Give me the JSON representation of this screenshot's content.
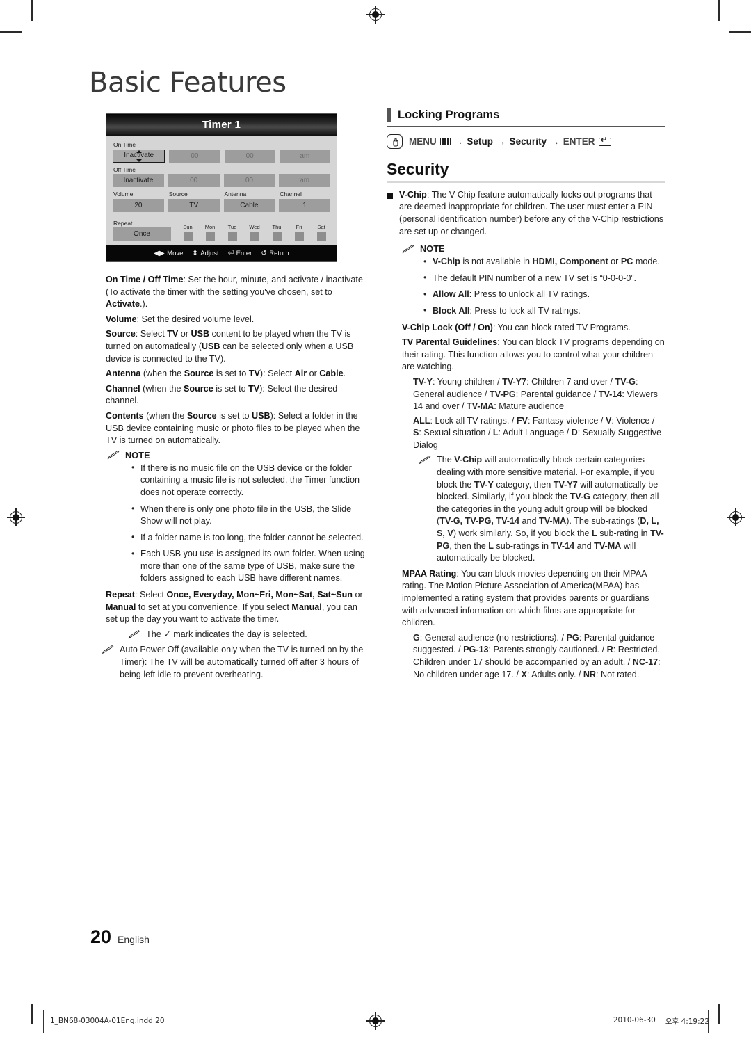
{
  "page": {
    "chapter_title": "Basic Features",
    "page_number": "20",
    "language": "English"
  },
  "osd": {
    "title": "Timer 1",
    "labels": {
      "on_time": "On Time",
      "off_time": "Off Time",
      "volume": "Volume",
      "source": "Source",
      "antenna": "Antenna",
      "channel": "Channel",
      "repeat": "Repeat"
    },
    "on_time": {
      "state": "Inactivate",
      "hour": "00",
      "minute": "00",
      "meridiem": "am"
    },
    "off_time": {
      "state": "Inactivate",
      "hour": "00",
      "minute": "00",
      "meridiem": "am"
    },
    "settings": {
      "volume": "20",
      "source": "TV",
      "antenna": "Cable",
      "channel": "1"
    },
    "repeat_value": "Once",
    "days": [
      "Sun",
      "Mon",
      "Tue",
      "Wed",
      "Thu",
      "Fri",
      "Sat"
    ],
    "footer_keys": [
      {
        "icon": "left-right-arrows-icon",
        "label": "Move"
      },
      {
        "icon": "up-down-arrows-icon",
        "label": "Adjust"
      },
      {
        "icon": "enter-key-icon",
        "label": "Enter"
      },
      {
        "icon": "return-arrow-icon",
        "label": "Return"
      }
    ]
  },
  "left_column": {
    "para_on_off_time": "On Time / Off Time: Set the hour, minute, and activate / inactivate (To activate the timer with the setting you've chosen, set to Activate.).",
    "para_volume": "Volume: Set the desired volume level.",
    "para_source": "Source: Select TV or USB content to be played when the TV is turned on automatically (USB can be selected only when a USB device is connected to the TV).",
    "para_antenna": "Antenna (when the Source is set to TV): Select Air or Cable.",
    "para_channel": "Channel (when the Source is set to TV): Select the desired channel.",
    "para_contents": "Contents (when the Source is set to USB): Select a folder in the USB device containing music or photo files to be played when the TV is turned on automatically.",
    "note_label": "NOTE",
    "notes": [
      "If there is no music file on the USB device or the folder containing a music file is not selected, the Timer function does not operate correctly.",
      "When there is only one photo file in the USB, the Slide Show will not play.",
      "If a folder name is too long, the folder cannot be selected.",
      "Each USB you use is assigned its own folder. When using more than one of the same type of USB, make sure the folders assigned to each USB have different names."
    ],
    "para_repeat": "Repeat: Select Once, Everyday, Mon~Fri, Mon~Sat, Sat~Sun or Manual to set at you convenience. If you select Manual, you can set up the day you want to activate the timer.",
    "note_checkmark": "The ✓ mark indicates the day is selected.",
    "note_auto_power_off": "Auto Power Off (available only when the TV is turned on by the Timer): The TV will be automatically turned off after 3 hours of being left idle to prevent overheating."
  },
  "right_column": {
    "heading_locking": "Locking Programs",
    "menu_path": {
      "icon": "finger-press-icon",
      "menu_label": "MENU",
      "menu_icon": "menu-bars-icon",
      "arrow": "→",
      "step_setup": "Setup",
      "step_security": "Security",
      "enter_label": "ENTER",
      "enter_icon": "enter-key-icon"
    },
    "heading_security": "Security",
    "para_vchip": "V-Chip: The V-Chip feature automatically locks out programs that are deemed inappropriate for children. The user must enter a PIN (personal identification number) before any of the V-Chip restrictions are set up or changed.",
    "note_label": "NOTE",
    "vchip_notes": [
      "V-Chip is not available in HDMI, Component or PC mode.",
      "The default PIN number of a new TV set is \"0-0-0-0\".",
      "Allow All: Press to unlock all TV ratings.",
      "Block All: Press to lock all TV ratings."
    ],
    "para_vchip_lock": "V-Chip Lock (Off / On): You can block rated TV Programs.",
    "para_parental": "TV Parental Guidelines: You can block TV programs depending on their rating. This function allows you to control what your children are watching.",
    "dash_ratings": "TV-Y: Young children / TV-Y7: Children 7 and over / TV-G: General audience / TV-PG: Parental guidance / TV-14: Viewers 14 and over / TV-MA: Mature audience",
    "dash_subratings": "ALL: Lock all TV ratings. / FV: Fantasy violence / V: Violence / S: Sexual situation / L: Adult Language / D: Sexually Suggestive Dialog",
    "note_autoblock": "The V-Chip will automatically block certain categories dealing with more sensitive material. For example, if you block the TV-Y category, then TV-Y7 will automatically be blocked. Similarly, if you block the TV-G category, then all the categories in the young adult group will be blocked (TV-G, TV-PG, TV-14 and TV-MA). The sub-ratings (D, L, S, V) work similarly. So, if you block the L sub-rating in TV-PG, then the L sub-ratings in TV-14 and TV-MA will automatically be blocked.",
    "para_mpaa": "MPAA Rating: You can block movies depending on their MPAA rating. The Motion Picture Association of America(MPAA) has implemented a rating system that provides parents or guardians with advanced information on which films are appropriate for children.",
    "dash_mpaa": "G: General audience (no restrictions). / PG: Parental guidance suggested. / PG-13: Parents strongly cautioned. / R: Restricted. Children under 17 should be accompanied by an adult. / NC-17: No children under age 17. / X: Adults only. / NR: Not rated."
  },
  "print_footer": {
    "file_name": "1_BN68-03004A-01Eng.indd   20",
    "date": "2010-06-30",
    "time": "오후 4:19:22"
  }
}
